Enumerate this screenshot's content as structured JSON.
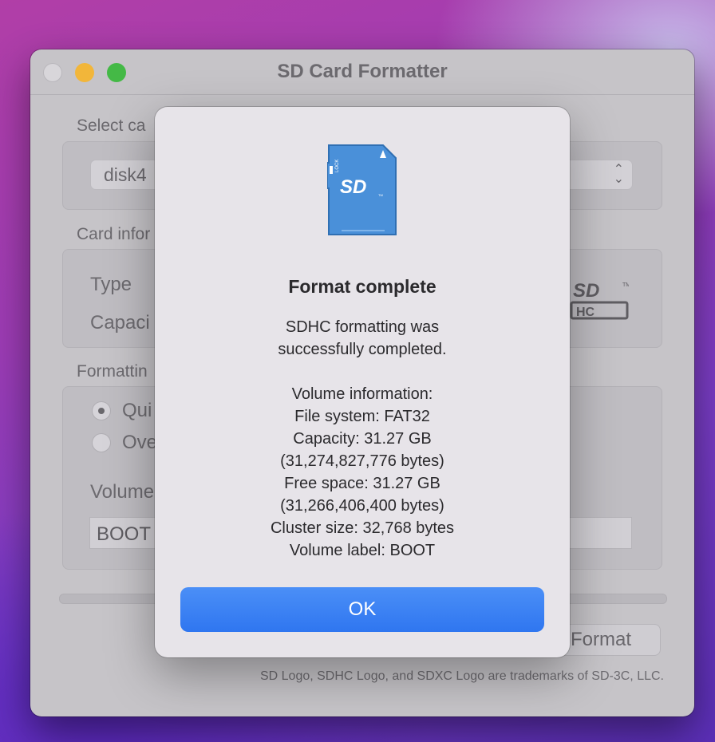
{
  "window": {
    "title": "SD Card Formatter",
    "select_card": {
      "label": "Select ca",
      "value": "disk4"
    },
    "card_info": {
      "label": "Card infor",
      "type_label": "Type",
      "capacity_label": "Capaci"
    },
    "formatting": {
      "label": "Formattin",
      "options": [
        "Qui",
        "Ove"
      ],
      "selected": 0,
      "volume_label": "Volume",
      "volume_value": "BOOT"
    },
    "format_button": "Format",
    "footer": "SD Logo, SDHC Logo, and SDXC Logo are trademarks of SD-3C, LLC."
  },
  "dialog": {
    "title": "Format complete",
    "message_lines": [
      "SDHC formatting was",
      "successfully completed.",
      "",
      "Volume information:",
      "File system: FAT32",
      "Capacity: 31.27 GB",
      "(31,274,827,776 bytes)",
      "Free space: 31.27 GB",
      "(31,266,406,400 bytes)",
      "Cluster size: 32,768 bytes",
      "Volume label: BOOT"
    ],
    "ok_button": "OK"
  },
  "icons": {
    "card": "sd-card-icon",
    "logo": "sdhc-logo-icon"
  },
  "colors": {
    "accent": "#3a82f5",
    "card_blue": "#4a90d9"
  }
}
